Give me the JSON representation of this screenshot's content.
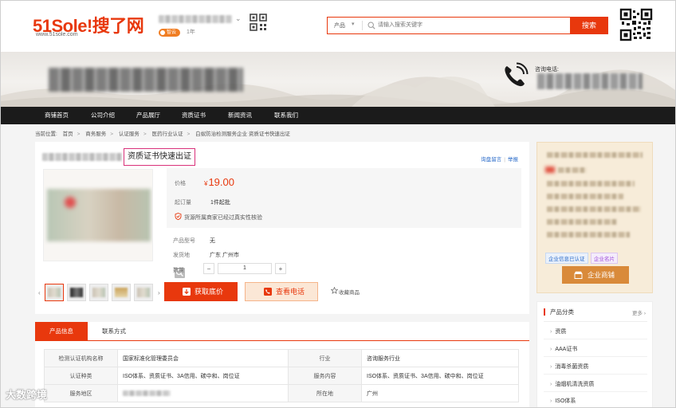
{
  "header": {
    "logo_text": "51Sole!搜了网",
    "logo_url": "www.51sole.com",
    "vip_label": "智云",
    "vip_years": "1年",
    "search": {
      "category": "产品",
      "placeholder": "请输入搜索关键字",
      "button_label": "搜索"
    }
  },
  "banner": {
    "phone_label": "咨询电话:"
  },
  "nav": {
    "items": [
      "商铺首页",
      "公司介绍",
      "产品展厅",
      "资质证书",
      "新闻资讯",
      "联系我们"
    ]
  },
  "breadcrumb": {
    "items": [
      "当前位置:",
      "首页",
      "商务服务",
      "认证服务",
      "医药行业认证",
      "白蚁防治检测服务企业 资质证书快速出证"
    ]
  },
  "product": {
    "title": "资质证书快速出证",
    "links": {
      "inquiry": "询盘留言",
      "report": "举报"
    },
    "price_label": "价格",
    "price_currency": "¥",
    "price_value": "19.00",
    "moq_label": "起订量",
    "moq_value": "1件起批",
    "verify_text": "货源所属商家已经过真实性核验",
    "model_label": "产品型号",
    "model_value": "无",
    "origin_label": "发货地",
    "origin_value": "广东 广州市",
    "qty_label": "数量",
    "qty_value": "1",
    "qty_minus": "−",
    "qty_plus": "+",
    "btn_quote": "获取底价",
    "btn_call": "查看电话",
    "fav_label": "收藏商品"
  },
  "tabs": [
    "产品信息",
    "联系方式"
  ],
  "spec_table": [
    [
      "检测认证机构名称",
      "国家标准化管理委员会",
      "行业",
      "咨询服务行业"
    ],
    [
      "认证种类",
      "ISO体系、资质证书、3A信用、碳中和、岗位证",
      "服务内容",
      "ISO体系、资质证书、3A信用、碳中和、岗位证"
    ],
    [
      "服务地区",
      "",
      "所在地",
      "广州"
    ]
  ],
  "company_card": {
    "tag_verified": "企业信息已认证",
    "tag_card": "企业名片",
    "shop_button": "企业商铺"
  },
  "categories": {
    "title": "产品分类",
    "more": "更多",
    "items": [
      "资质",
      "AAA证书",
      "消毒杀菌资质",
      "油烟机清洗资质",
      "ISO体系"
    ]
  },
  "watermark": "大数跨境",
  "colors": {
    "accent": "#e8380d",
    "nav_bg": "#1b1b1b",
    "link": "#2a6bc9",
    "shop_button": "#d98a3a"
  }
}
